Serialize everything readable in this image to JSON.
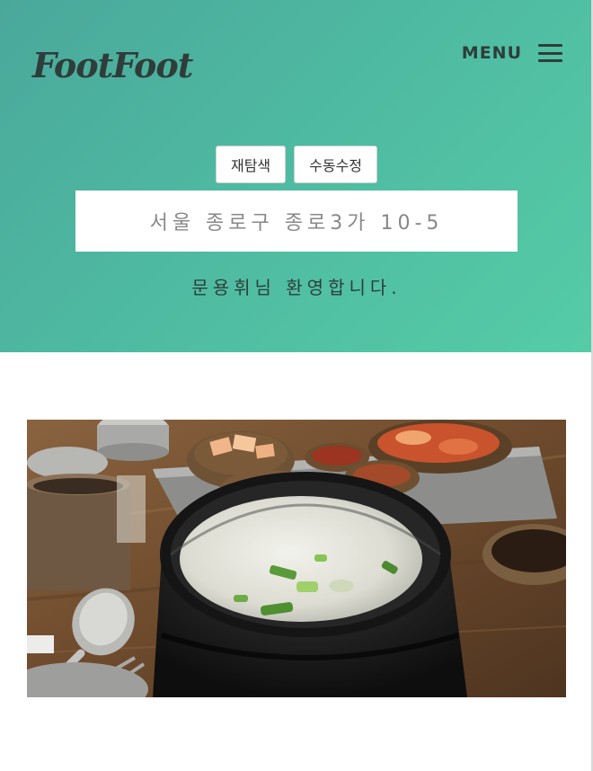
{
  "header": {
    "logo_text": "FootFoot",
    "menu_label": "MENU",
    "menu_icon": "hamburger-icon"
  },
  "actions": {
    "rescan_label": "재탐색",
    "manual_edit_label": "수동수정"
  },
  "location": {
    "address": "서울 종로구 종로3가 10-5"
  },
  "greeting": {
    "text": "문용휘님 환영합니다."
  },
  "colors": {
    "hero_start": "#4aa89b",
    "hero_end": "#55cca6",
    "text_dark": "#2f3d3a"
  }
}
